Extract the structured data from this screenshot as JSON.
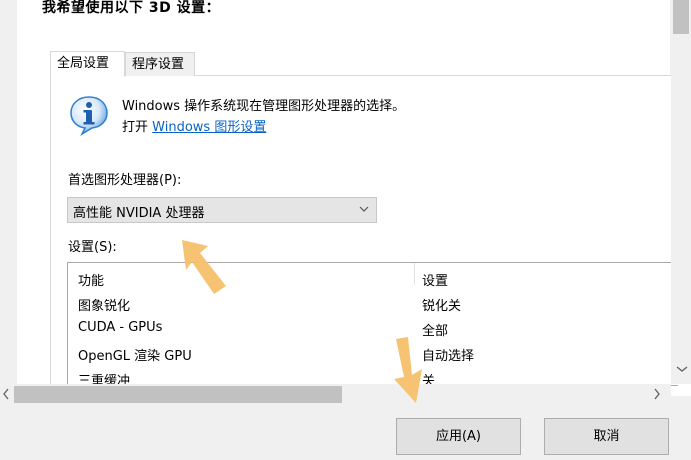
{
  "heading": "我希望使用以下 3D 设置：",
  "tabs": [
    {
      "label": "全局设置",
      "active": true
    },
    {
      "label": "程序设置",
      "active": false
    }
  ],
  "info": {
    "line1": "Windows 操作系统现在管理图形处理器的选择。",
    "line2_prefix": "打开",
    "line2_link": "Windows 图形设置"
  },
  "gpu": {
    "label": "首选图形处理器(P):",
    "selected": "高性能 NVIDIA 处理器"
  },
  "settings": {
    "label": "设置(S):",
    "columns": [
      "功能",
      "设置"
    ],
    "rows": [
      {
        "feature": "图象锐化",
        "value": "锐化关"
      },
      {
        "feature": "CUDA - GPUs",
        "value": "全部"
      },
      {
        "feature": "OpenGL 渲染 GPU",
        "value": "自动选择"
      },
      {
        "feature": "三重缓冲",
        "value": "关"
      }
    ]
  },
  "buttons": {
    "apply": "应用(A)",
    "cancel": "取消"
  },
  "colors": {
    "link": "#0a63c6",
    "hint_arrow": "#f5c06a",
    "info_icon": "#2f7fd0"
  },
  "icons": [
    "info-icon",
    "chevron-down-icon",
    "scroll-left-icon",
    "scroll-right-icon",
    "scroll-down-icon",
    "hint-arrow-icon"
  ]
}
